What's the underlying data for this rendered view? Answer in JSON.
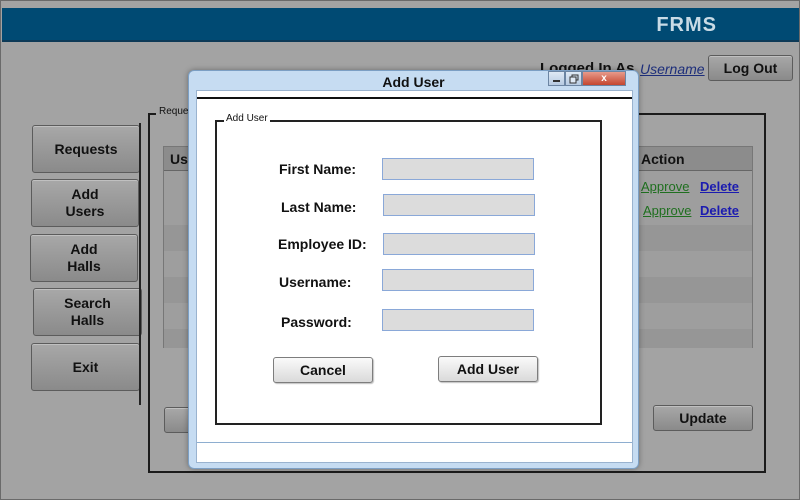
{
  "app": {
    "brand": "FRMS",
    "logged_in_label": "Logged In As",
    "username_link": "Username",
    "logout_label": "Log Out"
  },
  "sidebar": {
    "items": [
      {
        "label": "Requests"
      },
      {
        "label": "Add\nUsers"
      },
      {
        "label": "Add\nHalls"
      },
      {
        "label": "Search\nHalls"
      },
      {
        "label": "Exit"
      }
    ]
  },
  "panel": {
    "legend": "Reque",
    "table": {
      "headers": [
        "Us",
        "Action"
      ],
      "rows": [
        {
          "approve": "Approve",
          "delete": "Delete"
        },
        {
          "approve": "Approve",
          "delete": "Delete"
        }
      ]
    },
    "update_label": "Update"
  },
  "modal": {
    "title": "Add User",
    "window_controls": [
      "min-icon",
      "restore-icon",
      "close-icon"
    ],
    "close_glyph": "x",
    "group_label": "Add User",
    "fields": [
      {
        "label": "First Name:",
        "value": ""
      },
      {
        "label": "Last Name:",
        "value": ""
      },
      {
        "label": "Employee ID:",
        "value": ""
      },
      {
        "label": "Username:",
        "value": ""
      },
      {
        "label": "Password:",
        "value": ""
      }
    ],
    "cancel_label": "Cancel",
    "submit_label": "Add User"
  },
  "colors": {
    "header_bg": "#004a73",
    "brand_text": "#c9dbe6",
    "modal_frame": "#c6dcf2",
    "approve_link": "#1f6f1f",
    "delete_link": "#1b1bb0"
  }
}
